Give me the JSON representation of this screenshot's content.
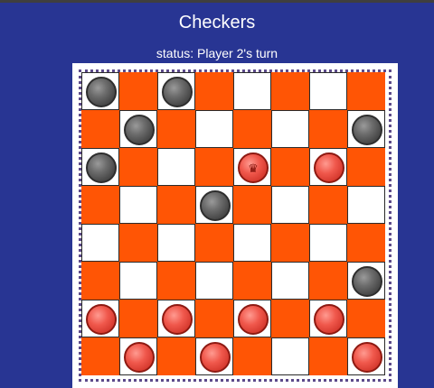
{
  "app": {
    "title": "Checkers",
    "status": "status: Player 2's turn"
  },
  "colors": {
    "background": "#283593",
    "dark_square": "#ff5505",
    "light_square": "#ffffff",
    "player1_piece": "red",
    "player2_piece": "black"
  },
  "board": {
    "rows": 8,
    "cols": 8,
    "pieces": [
      {
        "row": 0,
        "col": 0,
        "color": "black",
        "king": false
      },
      {
        "row": 0,
        "col": 2,
        "color": "black",
        "king": false
      },
      {
        "row": 1,
        "col": 1,
        "color": "black",
        "king": false
      },
      {
        "row": 1,
        "col": 7,
        "color": "black",
        "king": false
      },
      {
        "row": 2,
        "col": 0,
        "color": "black",
        "king": false
      },
      {
        "row": 2,
        "col": 4,
        "color": "red",
        "king": true
      },
      {
        "row": 2,
        "col": 6,
        "color": "red",
        "king": false
      },
      {
        "row": 3,
        "col": 3,
        "color": "black",
        "king": false
      },
      {
        "row": 5,
        "col": 7,
        "color": "black",
        "king": false
      },
      {
        "row": 6,
        "col": 0,
        "color": "red",
        "king": false
      },
      {
        "row": 6,
        "col": 2,
        "color": "red",
        "king": false
      },
      {
        "row": 6,
        "col": 4,
        "color": "red",
        "king": false
      },
      {
        "row": 6,
        "col": 6,
        "color": "red",
        "king": false
      },
      {
        "row": 7,
        "col": 1,
        "color": "red",
        "king": false
      },
      {
        "row": 7,
        "col": 3,
        "color": "red",
        "king": false
      },
      {
        "row": 7,
        "col": 7,
        "color": "red",
        "king": false
      }
    ],
    "king_icon": "crown-icon"
  }
}
